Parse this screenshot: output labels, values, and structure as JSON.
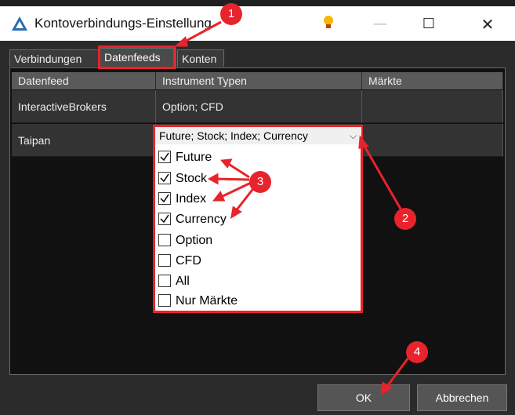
{
  "window": {
    "title": "Kontoverbindungs-Einstellung",
    "minimize": "—",
    "maximize": "☐",
    "close": "✕"
  },
  "tabs": [
    {
      "label": "Verbindungen"
    },
    {
      "label": "Datenfeeds"
    },
    {
      "label": "Konten"
    }
  ],
  "grid": {
    "headers": [
      "Datenfeed",
      "Instrument Typen",
      "Märkte"
    ],
    "rows": [
      {
        "datafeed": "InteractiveBrokers",
        "types": "Option; CFD",
        "markets": ""
      },
      {
        "datafeed": "Taipan",
        "types": "Future; Stock; Index; Currency",
        "markets": ""
      }
    ]
  },
  "dropdown": {
    "selected": "Future; Stock; Index; Currency",
    "options": [
      {
        "label": "Future",
        "checked": true
      },
      {
        "label": "Stock",
        "checked": true
      },
      {
        "label": "Index",
        "checked": true
      },
      {
        "label": "Currency",
        "checked": true
      },
      {
        "label": "Option",
        "checked": false
      },
      {
        "label": "CFD",
        "checked": false
      },
      {
        "label": "All",
        "checked": false
      },
      {
        "label": "Nur Märkte",
        "checked": false
      }
    ]
  },
  "buttons": {
    "ok": "OK",
    "cancel": "Abbrechen"
  },
  "annotations": [
    "1",
    "2",
    "3",
    "4"
  ],
  "colors": {
    "accent": "#e8232b",
    "dialog_bg": "#2b2b2b",
    "panel_bg": "#111111"
  }
}
